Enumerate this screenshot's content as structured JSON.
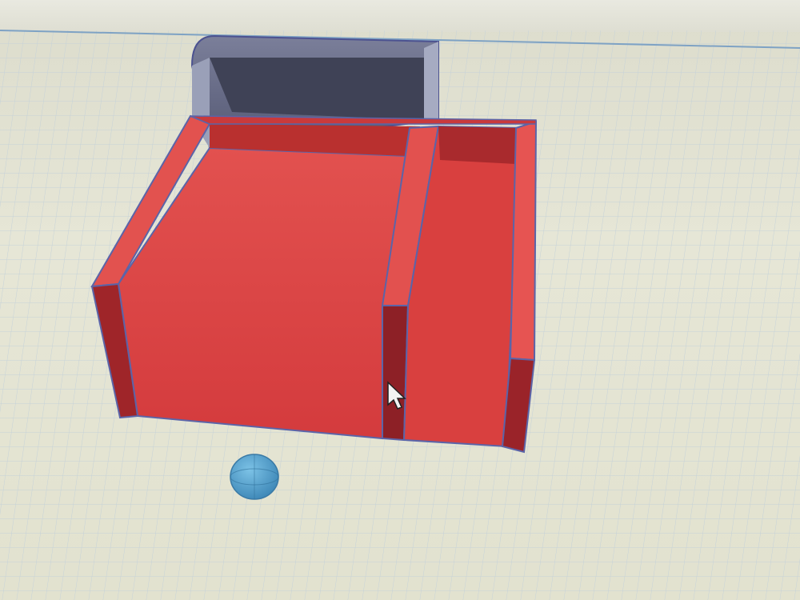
{
  "app": {
    "view": "3D workplane"
  },
  "model": {
    "body_color": "#d83a3c",
    "body_shadow_color": "#a22a2e",
    "hole_color": "#8a8ea6",
    "edge_color": "#5b64a8"
  },
  "workplane": {
    "grid_color": "#c9d3d6",
    "background_color": "#e3e3d2"
  },
  "icons": {
    "cursor": "cursor-arrow-icon",
    "view_cube": "nav-sphere-icon"
  },
  "nav_gizmo_color": "#4a9cc9"
}
